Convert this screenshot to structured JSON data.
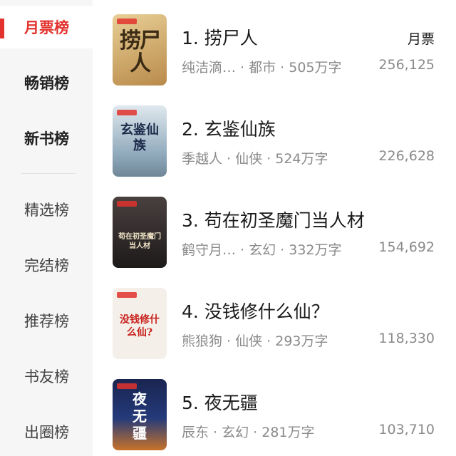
{
  "sidebar": {
    "items": [
      {
        "label": "月票榜"
      },
      {
        "label": "畅销榜"
      },
      {
        "label": "新书榜"
      },
      {
        "label": "精选榜"
      },
      {
        "label": "完结榜"
      },
      {
        "label": "推荐榜"
      },
      {
        "label": "书友榜"
      },
      {
        "label": "出圈榜"
      }
    ]
  },
  "header": {
    "metric_label": "月票"
  },
  "books": [
    {
      "title": "1. 捞尸人",
      "meta": "纯洁滴…  · 都市 · 505万字",
      "count": "256,125",
      "cover_text": "捞尸人",
      "cover_color": "#c9a46a"
    },
    {
      "title": "2. 玄鉴仙族",
      "meta": "季越人 · 仙侠 · 524万字",
      "count": "226,628",
      "cover_text": "玄鉴仙族",
      "cover_color": "#9fb7c8"
    },
    {
      "title": "3. 苟在初圣魔门当人材",
      "meta": "鹤守月…  · 玄幻 · 332万字",
      "count": "154,692",
      "cover_text": "苟在初圣魔门当人材",
      "cover_color": "#2b2626"
    },
    {
      "title": "4. 没钱修什么仙？",
      "meta": "熊狼狗 · 仙侠 · 293万字",
      "count": "118,330",
      "cover_text": "没钱修什么仙?",
      "cover_color": "#f1ece6"
    },
    {
      "title": "5. 夜无疆",
      "meta": "辰东 · 玄幻 · 281万字",
      "count": "103,710",
      "cover_text": "夜无疆",
      "cover_color": "#1b2a55"
    }
  ]
}
